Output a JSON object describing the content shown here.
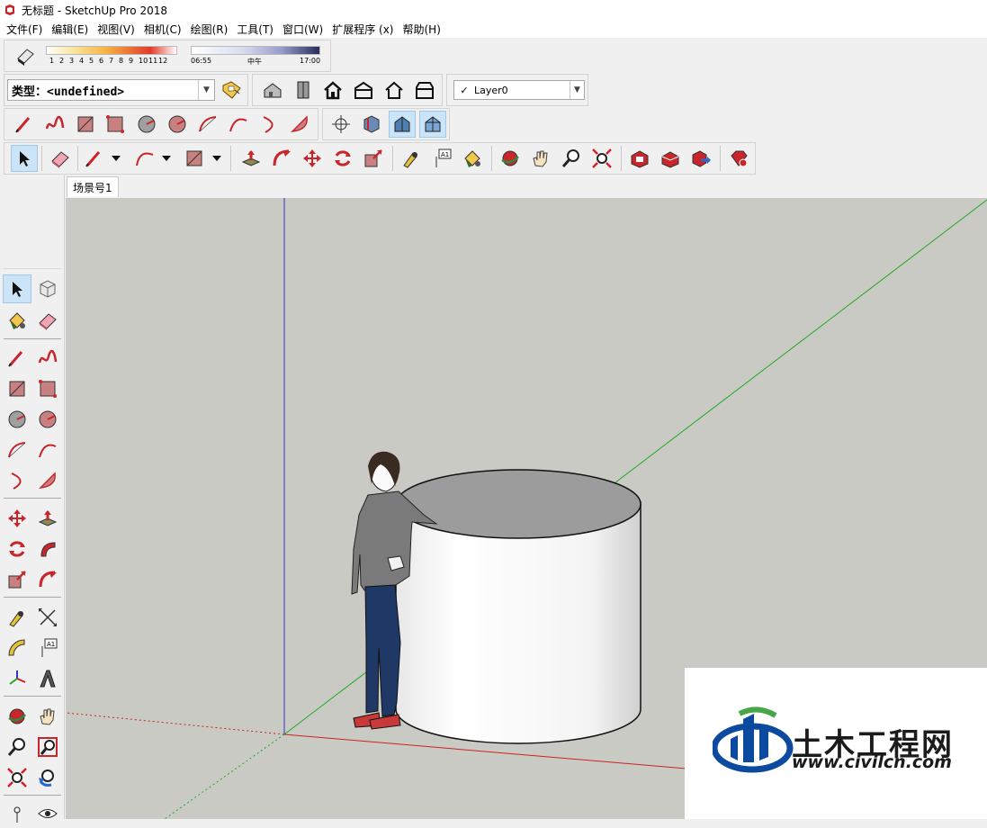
{
  "window": {
    "title": "无标题 - SketchUp Pro 2018"
  },
  "menu": [
    "文件(F)",
    "编辑(E)",
    "视图(V)",
    "相机(C)",
    "绘图(R)",
    "工具(T)",
    "窗口(W)",
    "扩展程序 (x)",
    "帮助(H)"
  ],
  "shadows": {
    "months": [
      "1",
      "2",
      "3",
      "4",
      "5",
      "6",
      "7",
      "8",
      "9",
      "10",
      "11",
      "12"
    ],
    "time_start": "06:55",
    "time_mid": "中午",
    "time_end": "17:00"
  },
  "tag_bar": {
    "type_label": "类型：<undefined>"
  },
  "layers": {
    "checked_mark": "✓",
    "current_layer": "Layer0"
  },
  "scene_tabs": [
    "场景号1"
  ],
  "watermark": {
    "name": "土木工程网",
    "url": "www.civilcn.com"
  },
  "colors": {
    "viewport_bg": "#c9cac3",
    "axis_red": "#cc2222",
    "axis_green": "#22aa22",
    "axis_blue": "#3333cc",
    "active_tool": "#cce4f7",
    "icon_red": "#c8262b"
  }
}
